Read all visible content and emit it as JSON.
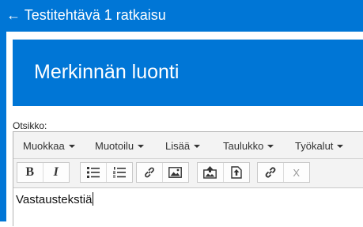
{
  "header": {
    "back_arrow": "←",
    "back_label": "Testitehtävä 1 ratkaisu"
  },
  "page": {
    "title": "Merkinnän luonti"
  },
  "form": {
    "field_label": "Otsikko:"
  },
  "editor": {
    "menus": [
      "Muokkaa",
      "Muotoilu",
      "Lisää",
      "Taulukko",
      "Työkalut"
    ],
    "toolbar": {
      "bold_label": "B",
      "italic_label": "I",
      "remove_format_label": "X",
      "icons": [
        "bold-icon",
        "italic-icon",
        "bullet-list-icon",
        "numbered-list-icon",
        "link-icon",
        "image-icon",
        "upload-image-icon",
        "upload-file-icon",
        "chain-link-icon",
        "remove-format-icon"
      ]
    },
    "content": "Vastaustekstiä"
  },
  "colors": {
    "brand_blue": "#0076d6",
    "toolbar_bg": "#f3f3f3",
    "border": "#c9c9c9"
  }
}
